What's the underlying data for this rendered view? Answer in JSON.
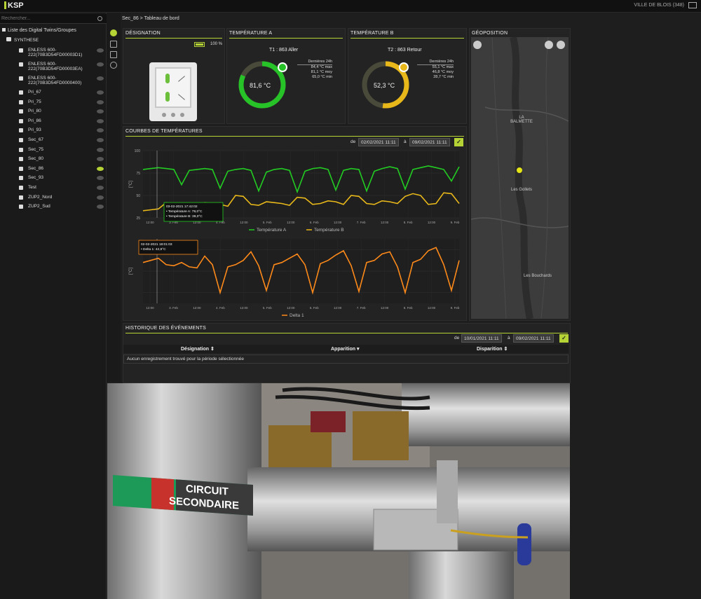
{
  "app": {
    "logo": "KSP",
    "city": "VILLE DE BLOIS (348)"
  },
  "search": {
    "placeholder": "Rechercher..."
  },
  "tree": {
    "root": "Liste des Digital Twins/Groupes",
    "group": "SYNTHESE",
    "items": [
      {
        "label": "ENLESS 600-",
        "label2": "222(70B3D54FD00003D1)",
        "two": true
      },
      {
        "label": "ENLESS 600-",
        "label2": "222(70B3D54FD00003EA)",
        "two": true
      },
      {
        "label": "ENLESS 600-",
        "label2": "222(70B3D54FD0000400)",
        "two": true
      },
      {
        "label": "Pri_67"
      },
      {
        "label": "Pri_75"
      },
      {
        "label": "Pri_80"
      },
      {
        "label": "Pri_86"
      },
      {
        "label": "Pri_93"
      },
      {
        "label": "Sec_67"
      },
      {
        "label": "Sec_75"
      },
      {
        "label": "Sec_80"
      },
      {
        "label": "Sec_86",
        "active": true
      },
      {
        "label": "Sec_93"
      },
      {
        "label": "Test"
      },
      {
        "label": "ZUP2_Nord"
      },
      {
        "label": "ZUP2_Sud"
      }
    ]
  },
  "breadcrumb": "Sec_86 > Tableau de bord",
  "designation": {
    "title": "DÉSIGNATION",
    "battery": "100 %"
  },
  "tempA": {
    "title": "TEMPÉRATURE A",
    "name": "T1 : 863 Aller",
    "value": "81,6 °C",
    "fill": 0.82,
    "color": "#27c227",
    "dernieres": "Dernières 24h",
    "max": "84,4 °C max",
    "moy": "81,1 °C moy",
    "min": "65,0 °C min"
  },
  "tempB": {
    "title": "TEMPÉRATURE B",
    "name": "T2 : 863 Retour",
    "value": "52,3 °C",
    "fill": 0.52,
    "color": "#e8b81a",
    "dernieres": "Dernières 24h",
    "max": "55,1 °C max",
    "moy": "46,8 °C moy",
    "min": "28,7 °C min"
  },
  "courbes": {
    "title": "COURBES DE TEMPÉRATURES",
    "de": "de",
    "from": "02/02/2021 11:11",
    "a": "à",
    "to": "09/02/2021 11:11"
  },
  "chart_data": [
    {
      "type": "line",
      "ylabel": "[°C]",
      "ytick_labels": [
        "100",
        "75",
        "50",
        "25"
      ],
      "ylim": [
        25,
        100
      ],
      "xtick_labels": [
        "12:00",
        "3. Feb",
        "12:00",
        "4. Feb",
        "12:00",
        "5. Feb",
        "12:00",
        "6. Feb",
        "12:00",
        "7. Feb",
        "12:00",
        "8. Feb",
        "12:00",
        "9. Feb"
      ],
      "series": [
        {
          "name": "Température A",
          "color": "#22cc22",
          "values": [
            79,
            80,
            81,
            80,
            79,
            62,
            78,
            79,
            80,
            79,
            58,
            77,
            79,
            80,
            78,
            55,
            76,
            79,
            80,
            78,
            54,
            77,
            80,
            81,
            79,
            56,
            78,
            80,
            79,
            55,
            77,
            80,
            82,
            80,
            57,
            79,
            81,
            83,
            81,
            79,
            66,
            82
          ]
        },
        {
          "name": "Température B",
          "color": "#e8b81a",
          "values": [
            33,
            34,
            35,
            42,
            40,
            41,
            40,
            38,
            42,
            41,
            40,
            38,
            50,
            49,
            40,
            39,
            43,
            42,
            41,
            39,
            48,
            47,
            40,
            41,
            44,
            43,
            40,
            50,
            49,
            41,
            40,
            44,
            43,
            41,
            49,
            52,
            50,
            40,
            41,
            53,
            52,
            41
          ]
        }
      ],
      "tooltip": {
        "date": "03-02-2021 17:42:02",
        "a": "Température A: 79,0°C",
        "b": "Température B: 39,0°C"
      }
    },
    {
      "type": "line",
      "ylabel": "[°C]",
      "xtick_labels": [
        "12:00",
        "3. Feb",
        "12:00",
        "4. Feb",
        "12:00",
        "5. Feb",
        "12:00",
        "6. Feb",
        "12:00",
        "7. Feb",
        "12:00",
        "8. Feb",
        "12:00",
        "9. Feb"
      ],
      "series": [
        {
          "name": "Delta 1",
          "color": "#ff8a1a",
          "values": [
            38,
            40,
            42,
            36,
            35,
            38,
            34,
            33,
            44,
            36,
            10,
            34,
            36,
            40,
            48,
            35,
            12,
            36,
            38,
            42,
            46,
            36,
            10,
            37,
            40,
            45,
            49,
            35,
            11,
            38,
            40,
            46,
            48,
            34,
            10,
            38,
            41,
            49,
            52,
            36,
            12,
            40
          ]
        }
      ],
      "tooltip": {
        "date": "02-02-2021 18:01:03",
        "d": "Delta 1: 42,8°C"
      }
    }
  ],
  "geoposition": {
    "title": "GÉOPOSITION",
    "places": [
      "LA BALMETTE",
      "Les Gollets",
      "Les Bouchards"
    ]
  },
  "events": {
    "title": "HISTORIQUE DES ÉVÉNEMENTS",
    "de": "de",
    "from": "10/01/2021 11:11",
    "a": "à",
    "to": "09/02/2021 11:11",
    "columns": [
      "Désignation",
      "Apparition",
      "Disparition"
    ],
    "empty": "Aucun enregistrement trouvé pour la période sélectionnée"
  },
  "photo": {
    "sign_line1": "CIRCUIT",
    "sign_line2": "SECONDAIRE"
  }
}
